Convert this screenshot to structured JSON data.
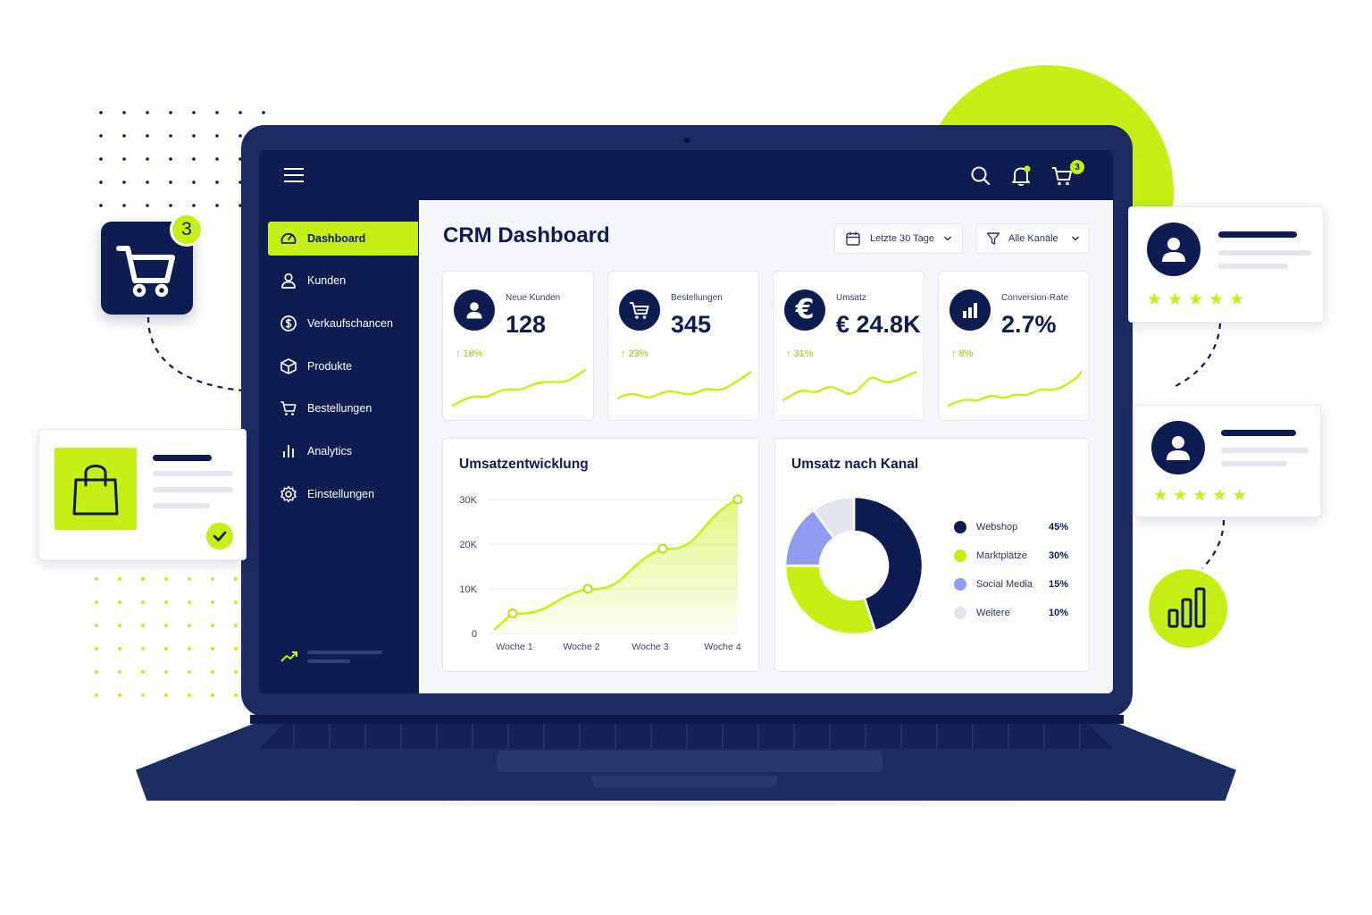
{
  "topbar": {
    "cart_count": "3"
  },
  "floating": {
    "cart_count": "3"
  },
  "sidebar": {
    "items": [
      {
        "label": "Dashboard",
        "icon": "speedometer-icon",
        "active": true
      },
      {
        "label": "Kunden",
        "icon": "user-icon"
      },
      {
        "label": "Verkaufschancen",
        "icon": "dollar-icon"
      },
      {
        "label": "Produkte",
        "icon": "box-icon"
      },
      {
        "label": "Bestellungen",
        "icon": "cart-icon"
      },
      {
        "label": "Analytics",
        "icon": "bar-chart-icon"
      },
      {
        "label": "Einstellungen",
        "icon": "gear-icon"
      }
    ]
  },
  "header": {
    "title": "CRM Dashboard",
    "date_filter": "Letzte 30 Tage",
    "channel_filter": "Alle Kanäle"
  },
  "kpis": [
    {
      "label": "Neue Kunden",
      "value": "128",
      "change": "18%",
      "icon": "user-icon"
    },
    {
      "label": "Bestellungen",
      "value": "345",
      "change": "23%",
      "icon": "cart-icon"
    },
    {
      "label": "Umsatz",
      "value": "€ 24.8K",
      "change": "31%",
      "icon": "euro-icon"
    },
    {
      "label": "Conversion-Rate",
      "value": "2.7%",
      "change": "8%",
      "icon": "bar-chart-icon"
    }
  ],
  "revenue_panel": {
    "title": "Umsatzentwicklung"
  },
  "channel_panel": {
    "title": "Umsatz nach Kanal"
  },
  "colors": {
    "navy": "#0f1c52",
    "lime": "#c6ef16",
    "periwinkle": "#8f9cf0",
    "grey": "#e1e4ec"
  },
  "chart_data": [
    {
      "type": "area",
      "title": "Umsatzentwicklung",
      "categories": [
        "Woche 1",
        "Woche 2",
        "Woche 3",
        "Woche 4"
      ],
      "values": [
        4500,
        10000,
        19000,
        30000
      ],
      "y_ticks": [
        "0",
        "10K",
        "20K",
        "30K"
      ],
      "ylim": [
        0,
        30000
      ],
      "grid": true
    },
    {
      "type": "pie",
      "title": "Umsatz nach Kanal",
      "legend_position": "right",
      "slices": [
        {
          "label": "Webshop",
          "value": 45,
          "value_label": "45%",
          "color": "#0f1c52"
        },
        {
          "label": "Marktplätze",
          "value": 30,
          "value_label": "30%",
          "color": "#c6ef16"
        },
        {
          "label": "Social Media",
          "value": 15,
          "value_label": "15%",
          "color": "#8f9cf0"
        },
        {
          "label": "Weitere",
          "value": 10,
          "value_label": "10%",
          "color": "#e1e4ec"
        }
      ]
    }
  ]
}
